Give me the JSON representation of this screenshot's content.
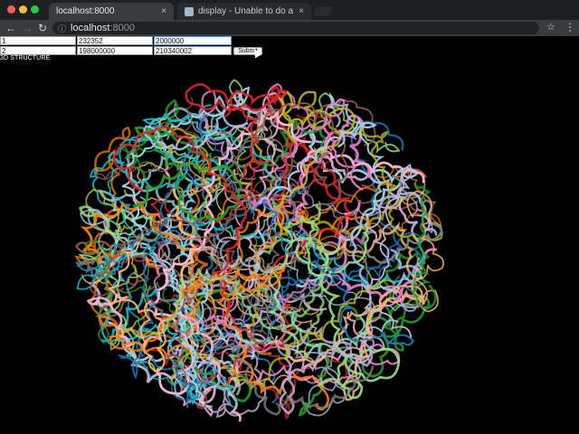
{
  "browser": {
    "tabs": [
      {
        "title": "localhost:8000",
        "close": "×"
      },
      {
        "title": "display - Unable to do a partic",
        "close": "×"
      }
    ],
    "address": {
      "host": "localhost",
      "port": ":8000"
    }
  },
  "form": {
    "row1": [
      "1",
      "232352",
      "2000000"
    ],
    "row2": [
      "2",
      "198000000",
      "210340002"
    ],
    "submit_label": "Submit"
  },
  "heading": "3D STRUCTURE",
  "visualization": {
    "palette": [
      "#e377c2",
      "#1f77b4",
      "#ff7f0e",
      "#9edae5",
      "#98df8a",
      "#ffbb78",
      "#c5b0d5",
      "#aec7e8",
      "#bcbd22",
      "#d62728",
      "#7f7f7f",
      "#f7b6d2",
      "#8c564b",
      "#17becf",
      "#2ca02c"
    ]
  }
}
